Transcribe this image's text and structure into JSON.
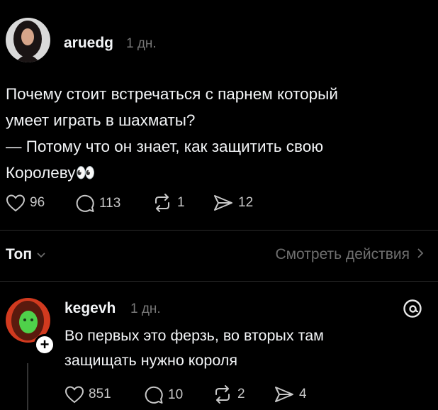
{
  "post": {
    "username": "aruedg",
    "time": "1 дн.",
    "text_lines": [
      "Почему стоит встречаться с парнем который",
      "умеет играть в шахматы?",
      "— Потому что он знает, как защитить свою",
      "Королеву👀"
    ],
    "likes": "96",
    "comments": "113",
    "reposts": "1",
    "shares": "12"
  },
  "replies_header": {
    "sort_label": "Топ",
    "activity_label": "Смотреть действия"
  },
  "reply": {
    "username": "kegevh",
    "time": "1 дн.",
    "text_lines": [
      "Во первых это ферзь, во вторых там",
      "защищать нужно короля"
    ],
    "follow_symbol": "+",
    "likes": "851",
    "comments": "10",
    "reposts": "2",
    "shares": "4"
  },
  "icons": {
    "like": "heart-icon",
    "comment": "comment-bubble-icon",
    "repost": "repost-icon",
    "share": "send-icon",
    "logo": "threads-logo-icon"
  },
  "colors": {
    "background": "#000000",
    "text": "#f3f5f7",
    "muted": "#777777"
  }
}
